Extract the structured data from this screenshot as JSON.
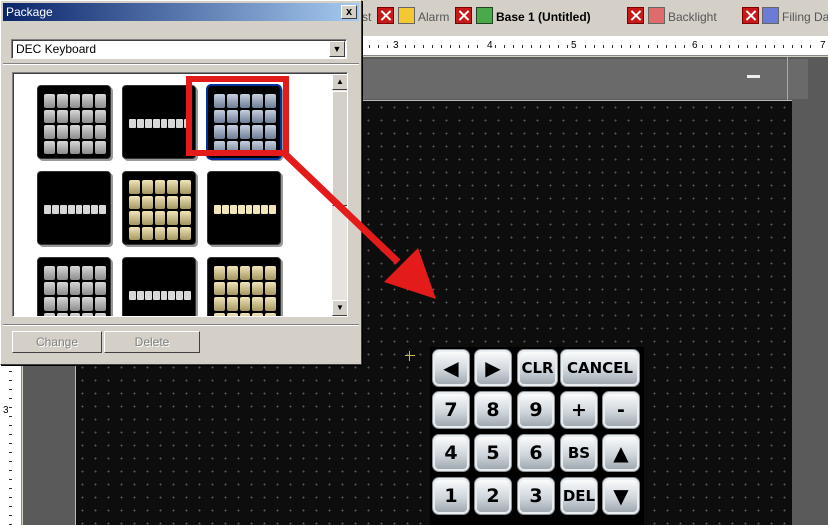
{
  "tabs": [
    {
      "label": "st",
      "active": false
    },
    {
      "label": "Alarm",
      "active": false
    },
    {
      "label": "Base 1 (Untitled)",
      "active": true
    },
    {
      "label": "Backlight",
      "active": false
    },
    {
      "label": "Filing Da",
      "active": false
    }
  ],
  "ruler": {
    "top_numbers": [
      "3",
      "4",
      "5",
      "6",
      "7"
    ],
    "left_numbers": [
      "3"
    ]
  },
  "package": {
    "title": "Package",
    "close_label": "x",
    "selected_package": "DEC Keyboard",
    "buttons": {
      "change": "Change",
      "delete": "Delete"
    },
    "thumbnails": [
      {
        "kind": "keypad",
        "theme": "gray",
        "selected": false
      },
      {
        "kind": "bar",
        "theme": "gray",
        "selected": false
      },
      {
        "kind": "keypad",
        "theme": "blue-gray",
        "selected": true
      },
      {
        "kind": "bar",
        "theme": "gray",
        "selected": false
      },
      {
        "kind": "keypad",
        "theme": "beige",
        "selected": false
      },
      {
        "kind": "bar",
        "theme": "beige",
        "selected": false
      },
      {
        "kind": "keypad",
        "theme": "gray",
        "selected": false
      },
      {
        "kind": "bar",
        "theme": "gray",
        "selected": false
      },
      {
        "kind": "keypad",
        "theme": "beige",
        "selected": false
      }
    ]
  },
  "keypad": {
    "rows": [
      [
        "◀",
        "▶",
        "CLR",
        "CANCEL"
      ],
      [
        "7",
        "8",
        "9",
        "+",
        "-"
      ],
      [
        "4",
        "5",
        "6",
        "BS",
        "▲"
      ],
      [
        "1",
        "2",
        "3",
        "DEL",
        "▼"
      ]
    ]
  },
  "colors": {
    "annotation_red": "#e31b1b",
    "canvas_background": "#0d0d0d",
    "selection_blue": "#00309c"
  }
}
